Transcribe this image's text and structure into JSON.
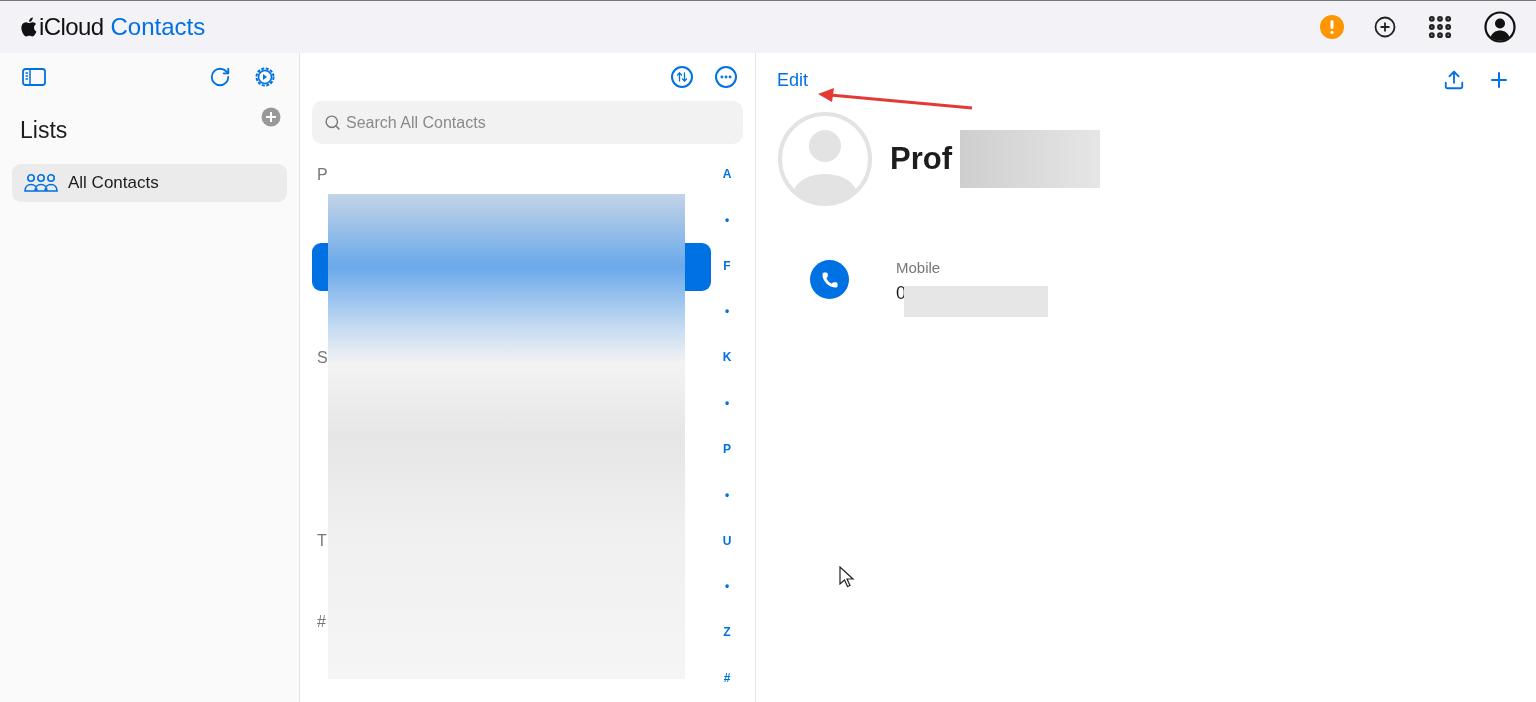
{
  "header": {
    "brand": "iCloud",
    "app": "Contacts"
  },
  "sidebar": {
    "title": "Lists",
    "items": [
      {
        "label": "All Contacts",
        "selected": true
      }
    ]
  },
  "contact_list": {
    "search": {
      "placeholder": "Search All Contacts"
    },
    "sections": [
      {
        "letter": "P",
        "rows": [
          {
            "selected": false
          },
          {
            "selected": true
          },
          {
            "selected": false
          }
        ]
      },
      {
        "letter": "S",
        "rows": [
          {
            "selected": false
          },
          {
            "selected": false
          },
          {
            "selected": false
          }
        ]
      },
      {
        "letter": "T",
        "rows": [
          {
            "selected": false
          }
        ]
      },
      {
        "letter": "#",
        "rows": [
          {
            "selected": false
          }
        ]
      }
    ],
    "index": [
      "A",
      "•",
      "F",
      "•",
      "K",
      "•",
      "P",
      "•",
      "U",
      "•",
      "Z",
      "#"
    ]
  },
  "detail": {
    "edit": "Edit",
    "name": "Prof",
    "fields": [
      {
        "label": "Mobile",
        "value": "0"
      }
    ]
  }
}
